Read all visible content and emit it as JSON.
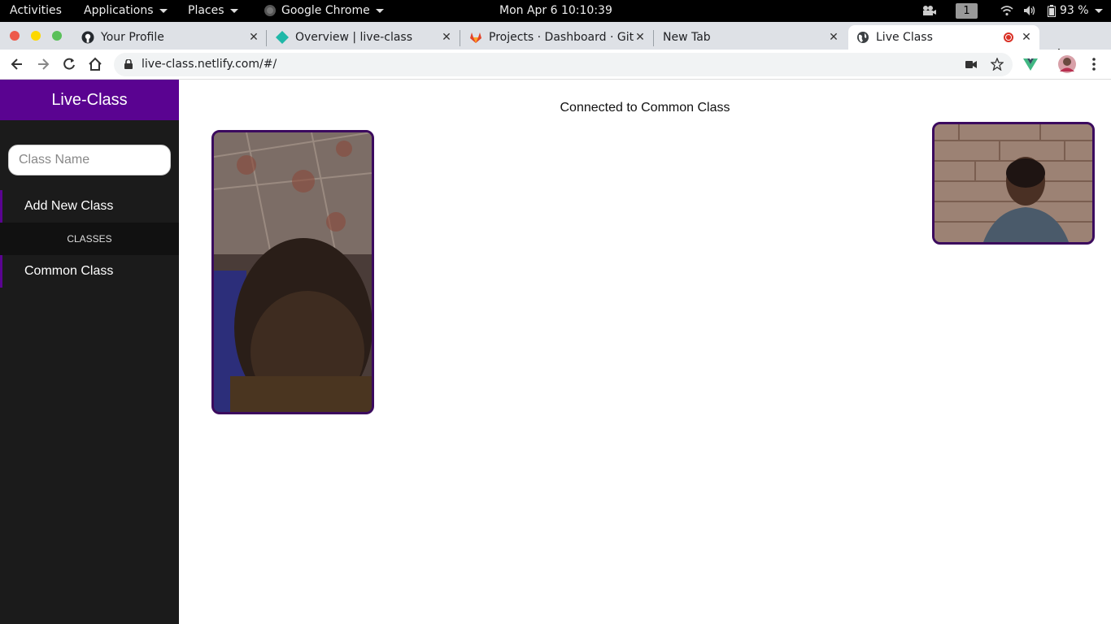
{
  "system_bar": {
    "activities": "Activities",
    "applications": "Applications",
    "places": "Places",
    "app_name": "Google Chrome",
    "clock": "Mon Apr 6  10:10:39",
    "workspace": "1",
    "battery": "93 %"
  },
  "tabs": [
    {
      "title": "Your Profile",
      "icon": "github-icon"
    },
    {
      "title": "Overview | live-class",
      "icon": "netlify-icon"
    },
    {
      "title": "Projects · Dashboard · GitL",
      "icon": "gitlab-icon"
    },
    {
      "title": "New Tab",
      "icon": ""
    },
    {
      "title": "Live Class",
      "icon": "globe-icon",
      "recording": true
    }
  ],
  "address_bar": {
    "url": "live-class.netlify.com/#/"
  },
  "sidebar": {
    "brand": "Live-Class",
    "class_input_placeholder": "Class Name",
    "add_new_class": "Add New Class",
    "section_header": "CLASSES",
    "classes": [
      "Common Class"
    ]
  },
  "main": {
    "status": "Connected to Common Class"
  },
  "colors": {
    "brand": "#5a0391",
    "sidebar_bg": "#1b1b1b",
    "video_border": "#3b0a5e"
  }
}
